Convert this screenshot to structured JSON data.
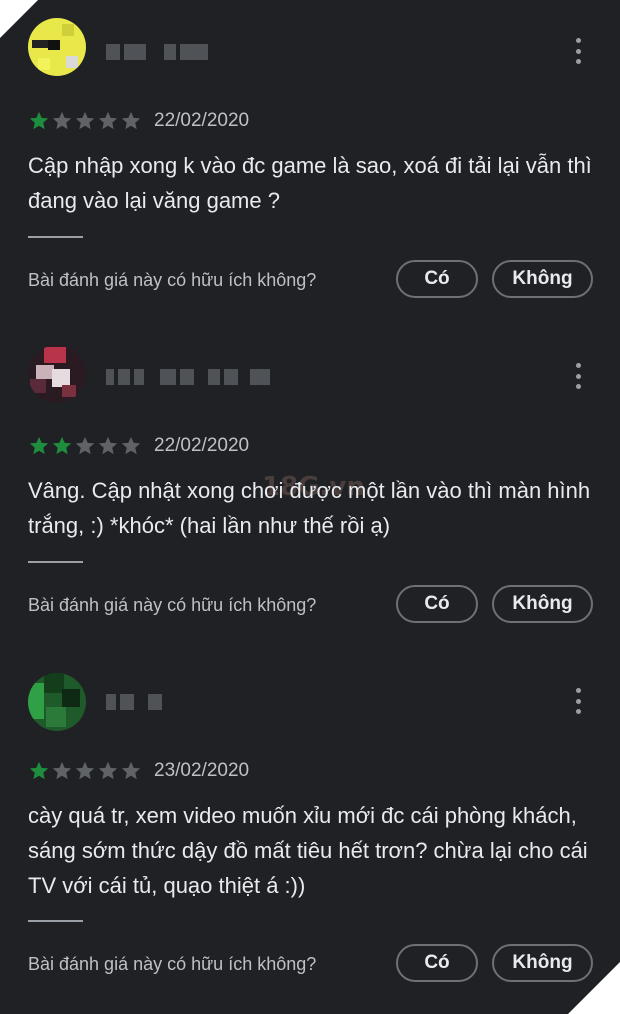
{
  "colors": {
    "background": "#202124",
    "star_filled": "#1e8e3e",
    "star_empty": "#5f6368",
    "text": "#e8eaed"
  },
  "watermark": "18G.vn",
  "reviews": [
    {
      "rating": 1,
      "max_rating": 5,
      "date": "22/02/2020",
      "text": "Cập nhập xong k vào đc game là sao, xoá đi tải lại vẫn thì đang vào lại văng game ?",
      "helpful_question": "Bài đánh giá này có hữu ích không?",
      "yes_label": "Có",
      "no_label": "Không"
    },
    {
      "rating": 2,
      "max_rating": 5,
      "date": "22/02/2020",
      "text": "Vâng. Cập nhật xong chơi được một lần vào thì màn hình trắng, :) *khóc* (hai lần như thế rồi ạ)",
      "helpful_question": "Bài đánh giá này có hữu ích không?",
      "yes_label": "Có",
      "no_label": "Không"
    },
    {
      "rating": 1,
      "max_rating": 5,
      "date": "23/02/2020",
      "text": "cày quá tr, xem video muốn xỉu mới đc cái phòng khách, sáng sớm thức dậy đồ mất tiêu hết trơn? chừa lại cho cái TV với cái tủ, quạo thiệt á :))",
      "helpful_question": "Bài đánh giá này có hữu ích không?",
      "yes_label": "Có",
      "no_label": "Không"
    }
  ]
}
